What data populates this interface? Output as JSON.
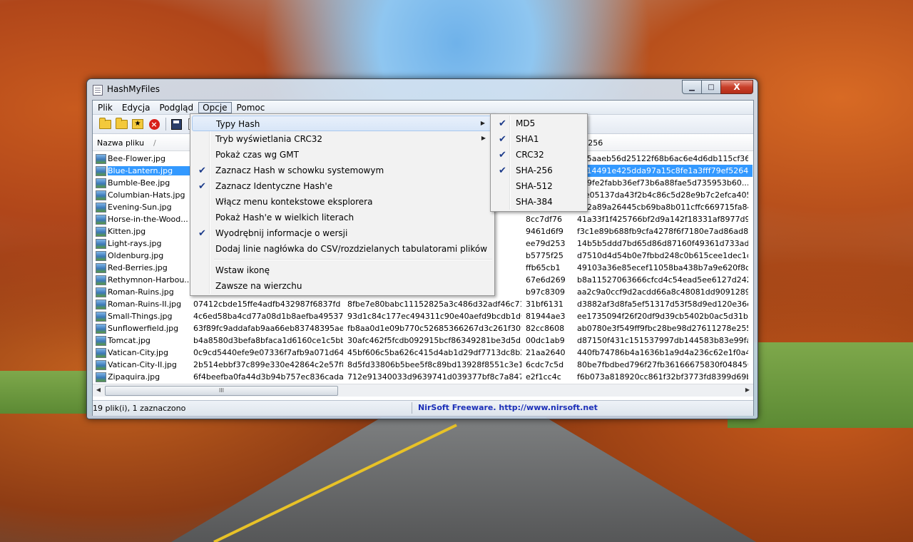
{
  "window": {
    "title": "HashMyFiles"
  },
  "caption": {
    "minimize": "▁",
    "maximize": "□",
    "close": "X"
  },
  "menubar": [
    "Plik",
    "Edycja",
    "Podgląd",
    "Opcje",
    "Pomoc"
  ],
  "columns": {
    "name": "Nazwa pliku",
    "sort_glyph": "/",
    "sha256": "A-256"
  },
  "rows": [
    {
      "name": "Bee-Flower.jpg",
      "c1": "",
      "c2": "",
      "c3": "",
      "c4": "1e5aaeb56d25122f68b6ac6e4d6db115cf36..."
    },
    {
      "name": "Blue-Lantern.jpg",
      "c1": "",
      "c2": "",
      "c3": "",
      "c4": "ee14491e425dda97a15c8fe1a3fff79ef5264...",
      "selected": true
    },
    {
      "name": "Bumble-Bee.jpg",
      "c1": "",
      "c2": "",
      "c3": "",
      "c4": "649fe2fabb36ef73b6a88fae5d735953b60..."
    },
    {
      "name": "Columbian-Hats.jpg",
      "c1": "",
      "c2": "",
      "c3": "",
      "c4": "f4e05137da43f2b4c86c5d28e9b7c2efca405..."
    },
    {
      "name": "Evening-Sun.jpg",
      "c1": "",
      "c2": "",
      "c3": "",
      "c4": "392a89a26445cb69ba8b011cffc669715fa84..."
    },
    {
      "name": "Horse-in-the-Wood...",
      "c1": "",
      "c2": "8b9a5",
      "c3": "8cc7df76",
      "c4": "41a33f1f425766bf2d9a142f18331af8977d982..."
    },
    {
      "name": "Kitten.jpg",
      "c1": "",
      "c2": "90fec8",
      "c3": "9461d6f9",
      "c4": "f3c1e89b688fb9cfa4278f6f7180e7ad86ad83d..."
    },
    {
      "name": "Light-rays.jpg",
      "c1": "",
      "c2": "7514",
      "c3": "ee79d253",
      "c4": "14b5b5ddd7bd65d86d87160f49361d733ad7..."
    },
    {
      "name": "Oldenburg.jpg",
      "c1": "",
      "c2": "dfc35",
      "c3": "b5775f25",
      "c4": "d7510d4d54b0e7fbbd248c0b615cee1dec1d7..."
    },
    {
      "name": "Red-Berries.jpg",
      "c1": "",
      "c2": "c875",
      "c3": "ffb65cb1",
      "c4": "49103a36e85ecef11058ba438b7a9e620f8d2fc..."
    },
    {
      "name": "Rethymnon-Harbou...",
      "c1": "",
      "c2": "f5b",
      "c3": "67e6d269",
      "c4": "b8a11527063666cfcd4c54ead5ee6127d24288..."
    },
    {
      "name": "Roman-Ruins.jpg",
      "c1": "",
      "c2": "188f",
      "c3": "b97c8309",
      "c4": "aa2c9a0ccf9d2acdd66a8c48081dd9091289d8..."
    },
    {
      "name": "Roman-Ruins-II.jpg",
      "c1": "07412cbde15ffe4adfb432987f6837fd",
      "c2": "8fbe7e80babc11152825a3c486d32adf46c71558",
      "c3": "31bf6131",
      "c4": "d3882af3d8fa5ef51317d53f58d9ed120e36ea..."
    },
    {
      "name": "Small-Things.jpg",
      "c1": "4c6ed58ba4cd77a08d1b8aefba49537c",
      "c2": "93d1c84c177ec494311c90e40aefd9bcdb1d0ca3",
      "c3": "81944ae3",
      "c4": "ee1735094f26f20df9d39cb5402b0ac5d31be5..."
    },
    {
      "name": "Sunflowerfield.jpg",
      "c1": "63f89fc9addafab9aa66eb83748395ae",
      "c2": "fb8aa0d1e09b770c52685366267d3c261f309047",
      "c3": "82cc8608",
      "c4": "ab0780e3f549ff9fbc28be98d27611278e25537..."
    },
    {
      "name": "Tomcat.jpg",
      "c1": "b4a8580d3befa8bfaca1d6160ce1c5bb",
      "c2": "30afc462f5fcdb092915bcf86349281be3d5d3dc",
      "c3": "00dc1ab9",
      "c4": "d87150f431c151537997db144583b83e99faaa..."
    },
    {
      "name": "Vatican-City.jpg",
      "c1": "0c9cd5440efe9e07336f7afb9a071d64",
      "c2": "45bf606c5ba626c415d4ab1d29df7713dc8b2...",
      "c3": "21aa2640",
      "c4": "440fb74786b4a1636b1a9d4a236c62e1f0a4fa..."
    },
    {
      "name": "Vatican-City-II.jpg",
      "c1": "2b514ebbf37c899e330e42864c2e57f8",
      "c2": "8d5fd33806b5bee5f8c89bd13928f8551c3e19f9",
      "c3": "6cdc7c5d",
      "c4": "80be7fbdbed796f27fb36166675830f0484569..."
    },
    {
      "name": "Zipaquira.jpg",
      "c1": "6f4beefba0fa44d3b94b757ec836cada",
      "c2": "712e91340033d9639741d039377bf8c7a84727...",
      "c3": "e2f1cc4c",
      "c4": "f6b073a818920cc861f32bf3773fd8399d69bb..."
    }
  ],
  "scrollbar": {
    "left": "◀",
    "right": "▶",
    "grip": "III"
  },
  "status": {
    "count": "19 plik(i), 1 zaznaczono",
    "credit": "NirSoft Freeware.  http://www.nirsoft.net"
  },
  "options_menu": [
    {
      "label": "Typy Hash",
      "checked": false,
      "submenu": true
    },
    {
      "label": "Tryb wyświetlania CRC32",
      "checked": false,
      "submenu": true
    },
    {
      "label": "Pokaż czas wg GMT",
      "checked": false
    },
    {
      "label": "Zaznacz Hash w schowku systemowym",
      "checked": true
    },
    {
      "label": "Zaznacz Identyczne Hash'e",
      "checked": true
    },
    {
      "label": "Włącz menu kontekstowe eksplorera",
      "checked": false
    },
    {
      "label": "Pokaż Hash'e w wielkich literach",
      "checked": false
    },
    {
      "label": "Wyodrębnij informacje o wersji",
      "checked": true
    },
    {
      "label": "Dodaj linie nagłówka do CSV/rozdzielanych tabulatorami plików",
      "checked": false
    },
    {
      "label": "Wstaw ikonę",
      "checked": false
    },
    {
      "label": "Zawsze na wierzchu",
      "checked": false
    }
  ],
  "hash_types_menu": [
    {
      "label": "MD5",
      "checked": true
    },
    {
      "label": "SHA1",
      "checked": true
    },
    {
      "label": "CRC32",
      "checked": true
    },
    {
      "label": "SHA-256",
      "checked": true
    },
    {
      "label": "SHA-512",
      "checked": false
    },
    {
      "label": "SHA-384",
      "checked": false
    }
  ],
  "glyphs": {
    "check": "✔",
    "arrow": "▶"
  },
  "colors": {
    "selection": "#3399ff",
    "credit_link": "#1b2fb8"
  }
}
